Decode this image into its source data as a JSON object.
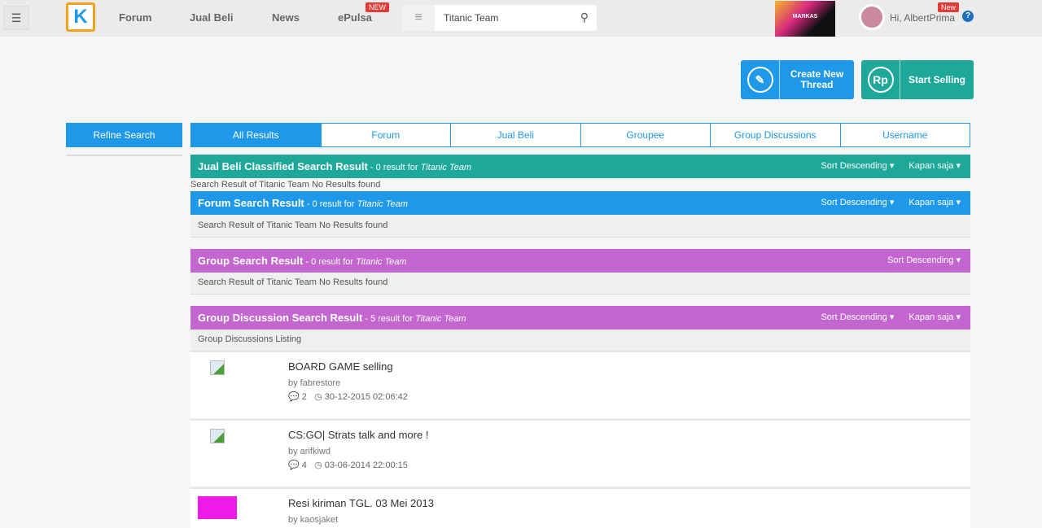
{
  "header": {
    "menu_icon": "hamburger-icon",
    "nav": [
      "Forum",
      "Jual Beli",
      "News",
      "ePulsa"
    ],
    "epulsa_badge": "NEW",
    "search_value": "Titanic Team",
    "banner_text": "MARKAS",
    "greeting": "Hi, AlbertPrima",
    "user_badge": "New",
    "help": "?"
  },
  "actions": {
    "create": "Create New Thread",
    "sell": "Start Selling",
    "sell_icon": "Rp"
  },
  "sidebar": {
    "refine": "Refine Search"
  },
  "tabs": [
    "All Results",
    "Forum",
    "Jual Beli",
    "Groupee",
    "Group Discussions",
    "Username"
  ],
  "colors": {
    "teal": "#1ea89a",
    "blue": "#1e98e8",
    "purple": "#c466d0"
  },
  "sections": [
    {
      "title": "Jual Beli Classified Search Result",
      "count": " - 0 result for ",
      "query": "Titanic Team",
      "sort": "Sort Descending ▾",
      "time": "Kapan saja ▾",
      "body": "Search Result of Titanic Team No Results found"
    },
    {
      "title": "Forum Search Result",
      "count": " - 0 result for ",
      "query": "Titanic Team",
      "sort": "Sort Descending ▾",
      "time": "Kapan saja ▾",
      "body": "Search Result of Titanic Team No Results found"
    },
    {
      "title": "Group Search Result",
      "count": " - 0 result for ",
      "query": "Titanic Team",
      "sort": "Sort Descending ▾",
      "body": "Search Result of Titanic Team No Results found"
    },
    {
      "title": "Group Discussion Search Result",
      "count": " - 5 result for ",
      "query": "Titanic Team",
      "sort": "Sort Descending ▾",
      "time": "Kapan saja ▾",
      "body": "Group Discussions Listing"
    }
  ],
  "items": [
    {
      "title": "BOARD GAME selling",
      "by": "by fabrestore",
      "comments": "2",
      "date": "30-12-2015 02:06:42"
    },
    {
      "title": "CS:GO| Strats talk and more !",
      "by": "by arifkiwd",
      "comments": "4",
      "date": "03-06-2014 22:00:15"
    },
    {
      "title": "Resi kiriman TGL. 03 Mei 2013",
      "by": "by kaosjaket"
    }
  ]
}
